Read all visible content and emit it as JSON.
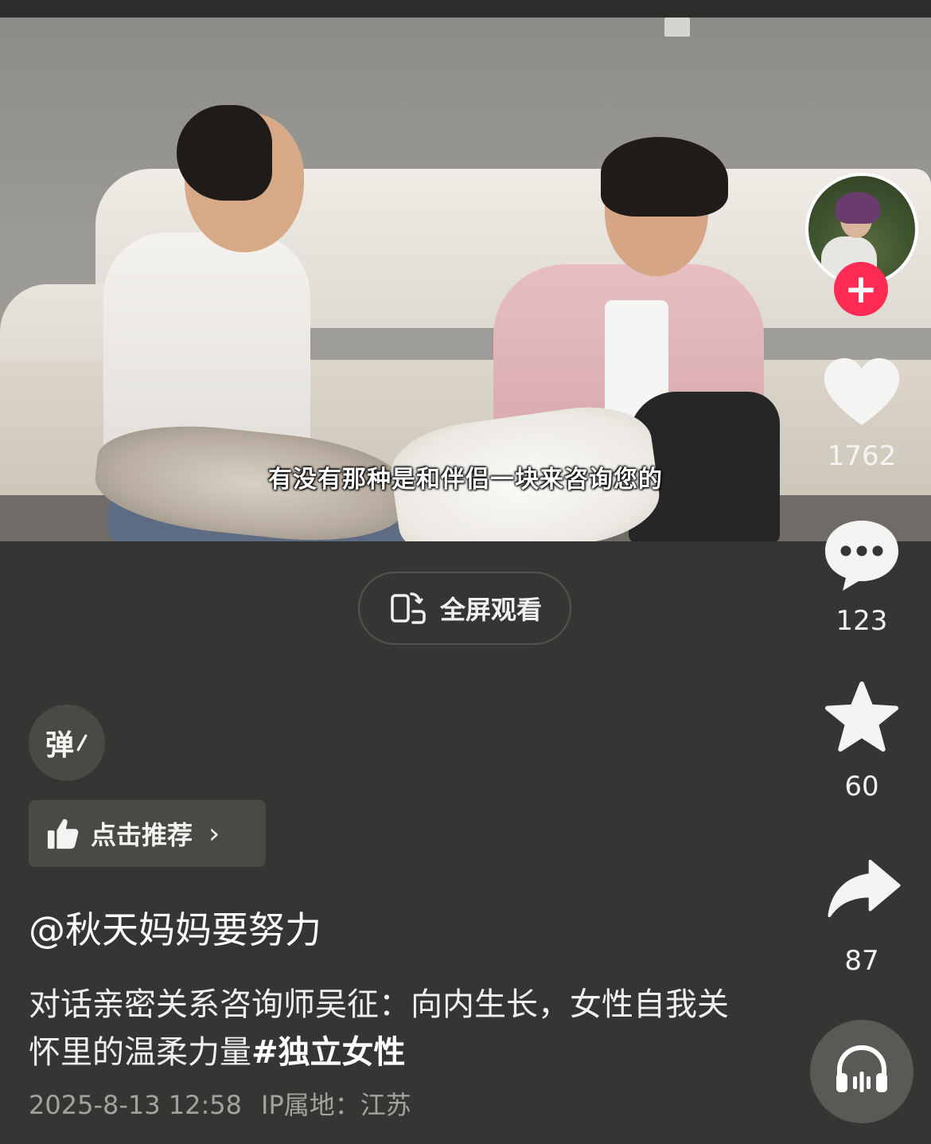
{
  "video": {
    "subtitle": "有没有那种是和伴侣一块来咨询您的"
  },
  "fullscreen_button": {
    "label": "全屏观看",
    "icon": "rotate-phone-icon"
  },
  "actions": {
    "like": {
      "icon": "heart-icon",
      "count": "1762"
    },
    "comment": {
      "icon": "comment-icon",
      "count": "123"
    },
    "favorite": {
      "icon": "star-icon",
      "count": "60"
    },
    "share": {
      "icon": "share-arrow-icon",
      "count": "87"
    },
    "follow": {
      "icon": "plus-icon",
      "symbol": "+"
    },
    "audio": {
      "icon": "headphones-icon"
    }
  },
  "danmaku": {
    "label": "弹"
  },
  "recommend": {
    "label": "点击推荐",
    "icon": "thumbs-up-icon",
    "chevron": "›"
  },
  "post": {
    "author": "@秋天妈妈要努力",
    "description": "对话亲密关系咨询师吴征：向内生长，女性自我关怀里的温柔力量",
    "hashtag": "#独立女性",
    "date": "2025-8-13 12:58",
    "location": "IP属地：江苏"
  },
  "colors": {
    "background": "#363533",
    "follow_red": "#fe2c55",
    "muted_text": "#a4a29e"
  }
}
